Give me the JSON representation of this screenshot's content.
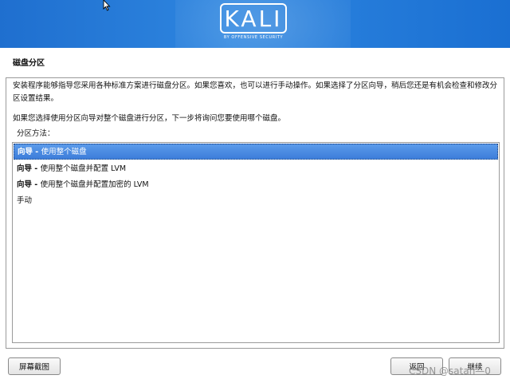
{
  "banner": {
    "logo_text": "KALI",
    "logo_subtitle": "BY OFFENSIVE SECURITY"
  },
  "page": {
    "title": "磁盘分区",
    "description": "安装程序能够指导您采用各种标准方案进行磁盘分区。如果您喜欢，也可以进行手动操作。如果选择了分区向导，稍后您还是有机会检查和修改分区设置结果。",
    "description2": "如果您选择使用分区向导对整个磁盘进行分区，下一步将询问您要使用哪个磁盘。",
    "method_label": "分区方法："
  },
  "options": {
    "items": [
      {
        "prefix": "向导 - ",
        "label": "使用整个磁盘",
        "selected": true
      },
      {
        "prefix": "向导 - ",
        "label": "使用整个磁盘并配置 LVM",
        "selected": false
      },
      {
        "prefix": "向导 - ",
        "label": "使用整个磁盘并配置加密的 LVM",
        "selected": false
      },
      {
        "prefix": "",
        "label": "手动",
        "selected": false
      }
    ],
    "selection_color": "#3d7dda"
  },
  "buttons": {
    "screenshot": "屏幕截图",
    "back": "返回",
    "continue": "继续"
  },
  "watermark": "CSDN @satan—0",
  "icons": {
    "cursor": "mouse-pointer-icon"
  },
  "colors": {
    "banner": "#2e86e0",
    "selection": "#3d7dda"
  }
}
